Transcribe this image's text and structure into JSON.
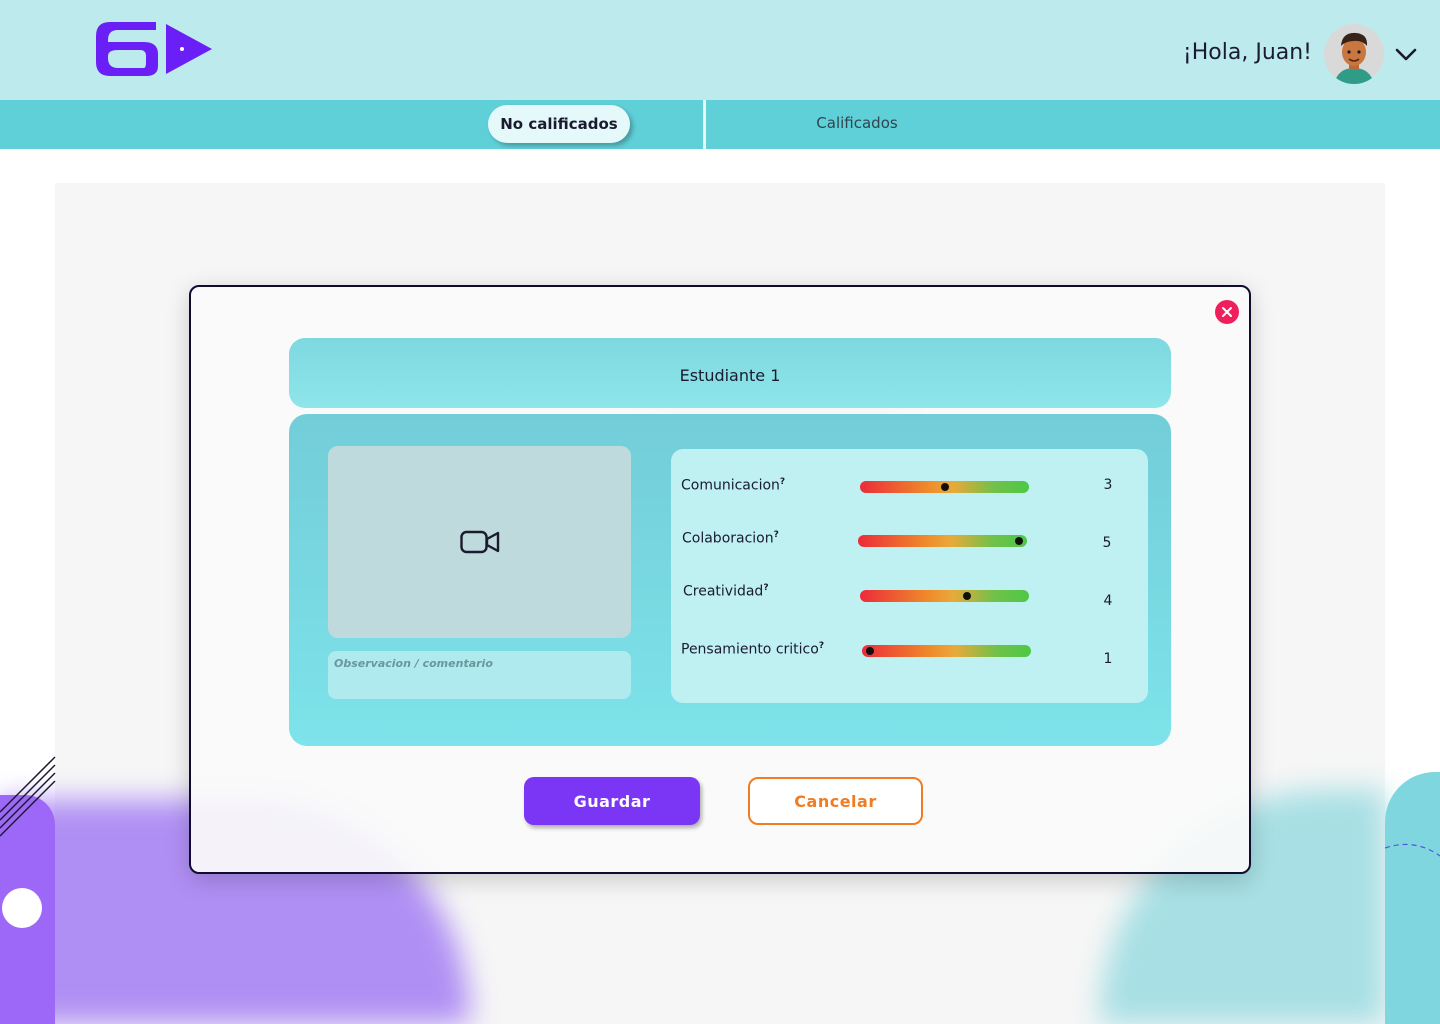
{
  "header": {
    "greeting": "¡Hola, Juan!",
    "logo_icon": "ed-play-logo",
    "avatar_icon": "avatar-boy",
    "menu_icon": "chevron-down-icon"
  },
  "tabs": {
    "active": "No calificados",
    "inactive": "Calificados"
  },
  "modal": {
    "student_name": "Estudiante 1",
    "video_icon": "video-camera-icon",
    "comment_placeholder": "Observacion / comentario",
    "skills": [
      {
        "label": "Comunicacion",
        "value": 3,
        "level": 0.5
      },
      {
        "label": "Colaboracion",
        "value": 5,
        "level": 1.0
      },
      {
        "label": "Creatividad",
        "value": 4,
        "level": 0.65
      },
      {
        "label": "Pensamiento critico",
        "value": 1,
        "level": 0.0
      }
    ],
    "save_label": "Guardar",
    "cancel_label": "Cancelar",
    "help_mark": "?"
  },
  "colors": {
    "header_bg": "#bdebed",
    "tabbar_bg": "#5fcfd8",
    "brand_purple": "#6b1ff7",
    "save_button": "#7b36f5",
    "cancel_border": "#f07c23",
    "close_button": "#ef1f5b",
    "modal_border": "#0f0c2e"
  }
}
